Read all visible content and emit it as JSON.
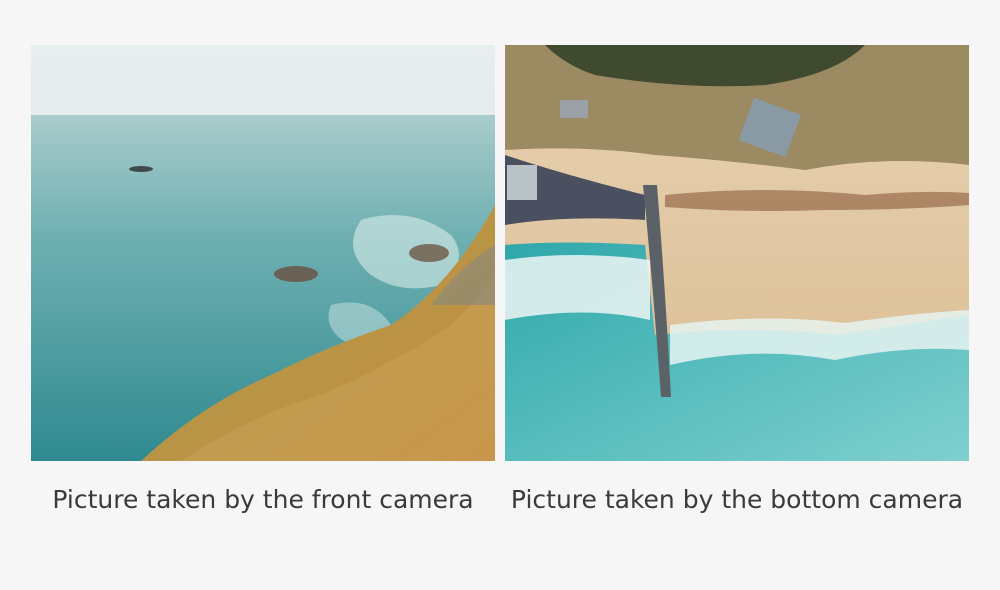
{
  "photos": {
    "front": {
      "caption": "Picture taken by the front camera",
      "scene": "sea-cliff-photo"
    },
    "bottom": {
      "caption": "Picture taken by the bottom camera",
      "scene": "aerial-beach-photo"
    }
  },
  "colors": {
    "background": "#f6f6f6",
    "caption_text": "#3a3a3a",
    "sea_front": "#4b9ea2",
    "sky_front": "#e4ecec",
    "cliff_grass": "#b08a3c",
    "sea_bottom": "#3fb7b9",
    "sand": "#e0c7a4",
    "dunes": "#8f7d5a"
  }
}
